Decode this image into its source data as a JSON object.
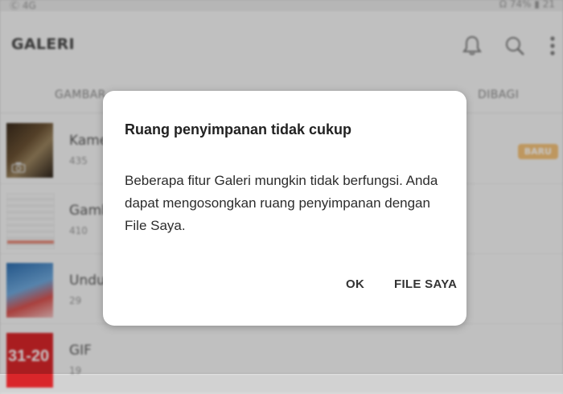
{
  "status_bar": {
    "left": "Ⓒ 4G",
    "right": "Ω 74% ▮ 21"
  },
  "app_bar": {
    "title": "GALERI",
    "icons": [
      "bell-icon",
      "search-icon",
      "more-vert-icon"
    ]
  },
  "tabs": [
    {
      "label": "GAMBAR"
    },
    {
      "label": "DIBAGI"
    }
  ],
  "albums": [
    {
      "name": "Kamera",
      "count": "435",
      "badge": "BARU",
      "icon": "camera-icon"
    },
    {
      "name": "Gambar",
      "count": "410"
    },
    {
      "name": "Unduhan",
      "count": "29"
    },
    {
      "name": "GIF",
      "count": "19",
      "thumb_text": "31-20"
    }
  ],
  "dialog": {
    "title": "Ruang penyimpanan tidak cukup",
    "message": "Beberapa fitur Galeri mungkin tidak berfungsi. Anda dapat mengosongkan ruang penyimpanan dengan File Saya.",
    "buttons": {
      "ok": "OK",
      "my_files": "FILE SAYA"
    }
  },
  "colors": {
    "scrim": "#000000",
    "badge": "#f4c27a",
    "dialog_bg": "#ffffff"
  }
}
